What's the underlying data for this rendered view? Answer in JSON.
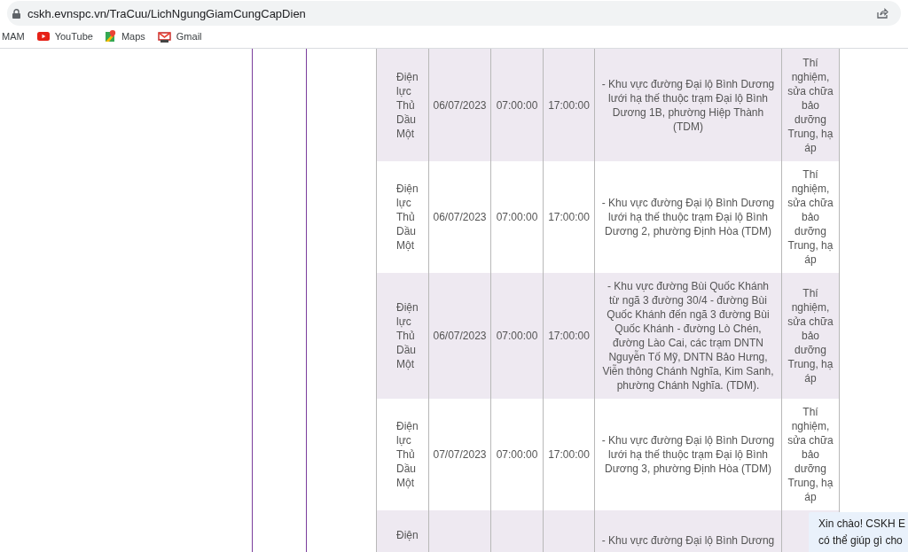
{
  "browser": {
    "url": "cskh.evnspc.vn/TraCuu/LichNgungGiamCungCapDien",
    "bookmarks": [
      {
        "kind": "text",
        "label": "MAM"
      },
      {
        "kind": "youtube",
        "label": "YouTube"
      },
      {
        "kind": "maps",
        "label": "Maps"
      },
      {
        "kind": "gmail",
        "label": "Gmail"
      }
    ]
  },
  "table": {
    "rows": [
      {
        "unit": "Điện lực Thủ Dầu Một",
        "date": "06/07/2023",
        "start": "07:00:00",
        "end": "17:00:00",
        "description": "- Khu vực đường Đại lộ Bình Dương lưới hạ thế thuộc trạm Đại lộ Bình Dương 1B, phường Hiệp Thành (TDM)",
        "reason": "Thí nghiệm, sửa chữa bảo dưỡng Trung, hạ áp"
      },
      {
        "unit": "Điện lực Thủ Dầu Một",
        "date": "06/07/2023",
        "start": "07:00:00",
        "end": "17:00:00",
        "description": "- Khu vực đường Đại lộ Bình Dương lưới hạ thế thuộc trạm Đại lộ Bình Dương 2, phường Định Hòa (TDM)",
        "reason": "Thí nghiệm, sửa chữa bảo dưỡng Trung, hạ áp"
      },
      {
        "unit": "Điện lực Thủ Dầu Một",
        "date": "06/07/2023",
        "start": "07:00:00",
        "end": "17:00:00",
        "description": "- Khu vực đường Bùi Quốc Khánh từ ngã 3 đường 30/4 - đường Bùi Quốc Khánh đến ngã 3 đường Bùi Quốc Khánh - đường Lò Chén, đường Lào Cai, các trạm DNTN Nguyễn Tố Mỹ, DNTN Bảo Hưng, Viễn thông Chánh Nghĩa, Kim Sanh, phường Chánh Nghĩa. (TDM).",
        "reason": "Thí nghiệm, sửa chữa bảo dưỡng Trung, hạ áp"
      },
      {
        "unit": "Điện lực Thủ Dầu Một",
        "date": "07/07/2023",
        "start": "07:00:00",
        "end": "17:00:00",
        "description": "- Khu vực đường Đại lộ Bình Dương lưới hạ thế thuộc trạm Đại lộ Bình Dương 3, phường Định Hòa (TDM)",
        "reason": "Thí nghiệm, sửa chữa bảo dưỡng Trung, hạ áp"
      },
      {
        "unit": "Điện",
        "description": "- Khu vực đường Đại lộ Bình Dương"
      }
    ]
  },
  "chat": {
    "lines": [
      "Xin chào! CSKH E",
      "có thể giúp gì cho"
    ]
  }
}
